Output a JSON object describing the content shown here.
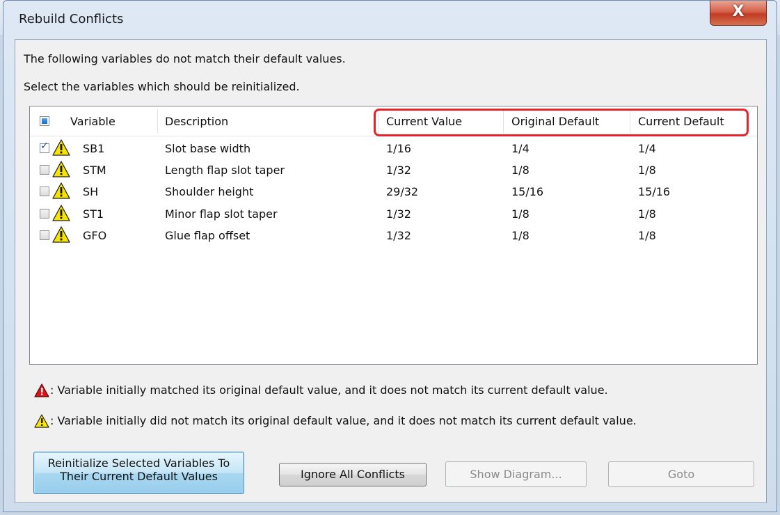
{
  "window": {
    "title": "Rebuild Conflicts",
    "close_glyph": "X"
  },
  "instructions": {
    "line1": "The following variables do not match their default values.",
    "line2": "Select the variables which should be reinitialized."
  },
  "table": {
    "columns": {
      "variable": "Variable",
      "description": "Description",
      "current_value": "Current Value",
      "original_default": "Original Default",
      "current_default": "Current Default"
    },
    "header_checkbox_state": "partial",
    "highlight_color": "#e8222a",
    "rows": [
      {
        "checked": true,
        "icon": "yellow-warning-icon",
        "variable": "SB1",
        "description": "Slot base width",
        "current_value": "1/16",
        "original_default": "1/4",
        "current_default": "1/4"
      },
      {
        "checked": false,
        "icon": "yellow-warning-icon",
        "variable": "STM",
        "description": "Length flap slot taper",
        "current_value": "1/32",
        "original_default": "1/8",
        "current_default": "1/8"
      },
      {
        "checked": false,
        "icon": "yellow-warning-icon",
        "variable": "SH",
        "description": "Shoulder height",
        "current_value": "29/32",
        "original_default": "15/16",
        "current_default": "15/16"
      },
      {
        "checked": false,
        "icon": "yellow-warning-icon",
        "variable": "ST1",
        "description": "Minor flap slot taper",
        "current_value": "1/32",
        "original_default": "1/8",
        "current_default": "1/8"
      },
      {
        "checked": false,
        "icon": "yellow-warning-icon",
        "variable": "GFO",
        "description": "Glue flap offset",
        "current_value": "1/32",
        "original_default": "1/8",
        "current_default": "1/8"
      }
    ]
  },
  "legend": {
    "red": {
      "icon": "red-warning-icon",
      "text": ": Variable initially matched its original default value, and it does not match its current default value."
    },
    "yellow": {
      "icon": "yellow-warning-icon",
      "text": ": Variable initially did not match its original default value, and it does not match its current default value."
    }
  },
  "buttons": {
    "reinit_line1": "Reinitialize Selected Variables To",
    "reinit_line2": "Their Current Default Values",
    "ignore": "Ignore All Conflicts",
    "show_diagram": "Show Diagram...",
    "goto": "Goto"
  },
  "colors": {
    "warning_yellow": "#f7e400",
    "warning_red": "#d8141c",
    "primary_button": "#a9d8f1",
    "close_button": "#c94a33"
  }
}
